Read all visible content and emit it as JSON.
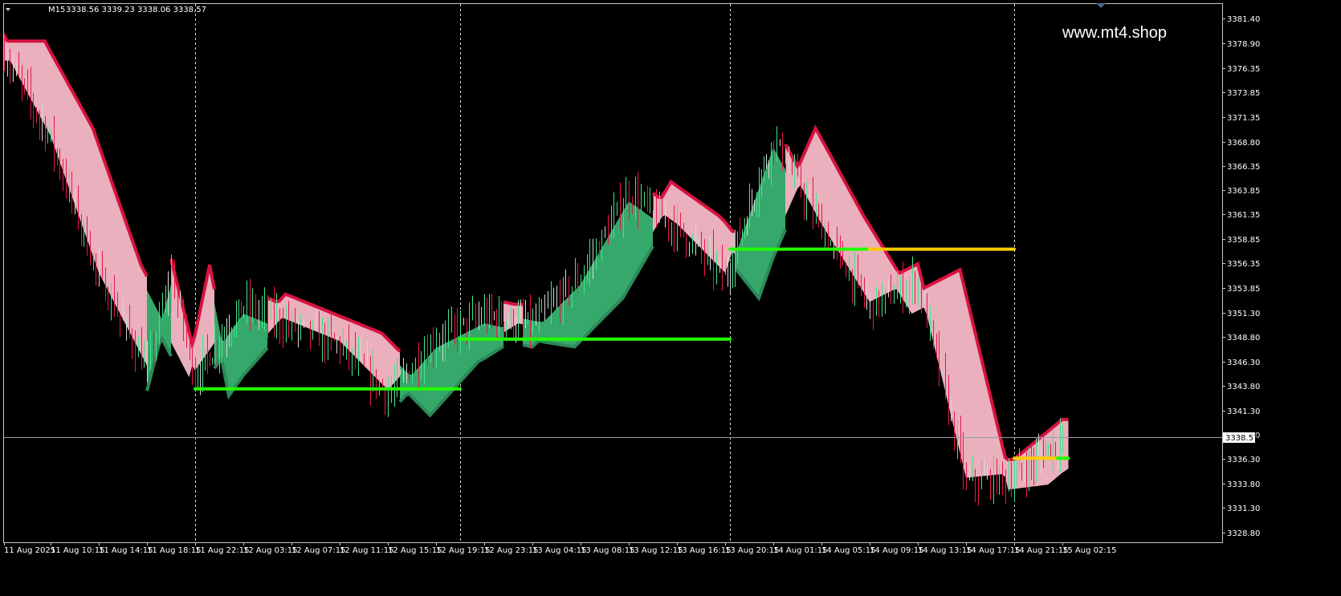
{
  "header": {
    "timeframe": "M15",
    "ohlc": "3338.56 3339.23 3338.06 3338.57"
  },
  "watermark": "www.mt4.shop",
  "colors": {
    "background": "#000000",
    "frame": "#c8c8c8",
    "grid": "#ffffff",
    "bull_candle": "#3ee68e",
    "bear_candle": "#e8174a",
    "doji_candle": "#d8d8d8",
    "bear_band_fill": "#eab0bd",
    "bear_band_edge": "#d6123f",
    "bull_band_fill": "#37a86b",
    "bull_band_edge": "#2c8a58",
    "level_bull": "#22ff00",
    "level_bear": "#ffcc00",
    "price_line": "#8fa0b0"
  },
  "chart_data": {
    "type": "candlestick",
    "symbol_timeframe": "M15",
    "current_price": "3338.57",
    "ylim": [
      3327.8,
      3382.9
    ],
    "y_ticks": [
      "3381.40",
      "3378.90",
      "3376.35",
      "3373.85",
      "3371.35",
      "3368.80",
      "3366.35",
      "3363.85",
      "3361.35",
      "3358.85",
      "3356.35",
      "3353.85",
      "3351.30",
      "3348.80",
      "3346.30",
      "3343.80",
      "3341.30",
      "3338.80",
      "3336.30",
      "3333.80",
      "3331.30",
      "3328.80"
    ],
    "x_ticks": [
      "11 Aug 2025",
      "11 Aug 10:15",
      "11 Aug 14:15",
      "11 Aug 18:15",
      "11 Aug 22:15",
      "12 Aug 03:15",
      "12 Aug 07:15",
      "12 Aug 11:15",
      "12 Aug 15:15",
      "12 Aug 19:15",
      "12 Aug 23:15",
      "13 Aug 04:15",
      "13 Aug 08:15",
      "13 Aug 12:15",
      "13 Aug 16:15",
      "13 Aug 20:15",
      "14 Aug 01:15",
      "14 Aug 05:15",
      "14 Aug 09:15",
      "14 Aug 13:15",
      "14 Aug 17:15",
      "14 Aug 21:15",
      "15 Aug 02:15"
    ],
    "day_separators": [
      "11 Aug 22:15",
      "12 Aug 21:15",
      "13 Aug 20:45",
      "14 Aug 21:15"
    ],
    "price_path": [
      [
        "11 Aug 2025",
        3377.9
      ],
      [
        "11 Aug 10:15",
        3369.0
      ],
      [
        "11 Aug 14:15",
        3355.0
      ],
      [
        "11 Aug 18:15",
        3345.5
      ],
      [
        "11 Aug 20:15",
        3355.0
      ],
      [
        "11 Aug 22:15",
        3345.0
      ],
      [
        "12 Aug 03:15",
        3352.0
      ],
      [
        "12 Aug 07:15",
        3350.0
      ],
      [
        "12 Aug 11:15",
        3348.0
      ],
      [
        "12 Aug 15:15",
        3343.0
      ],
      [
        "12 Aug 19:15",
        3348.5
      ],
      [
        "12 Aug 23:15",
        3351.0
      ],
      [
        "13 Aug 04:15",
        3350.0
      ],
      [
        "13 Aug 08:15",
        3355.0
      ],
      [
        "13 Aug 12:15",
        3363.5
      ],
      [
        "13 Aug 16:15",
        3360.0
      ],
      [
        "13 Aug 20:15",
        3355.0
      ],
      [
        "14 Aug 01:15",
        3369.0
      ],
      [
        "14 Aug 05:15",
        3360.0
      ],
      [
        "14 Aug 09:15",
        3352.0
      ],
      [
        "14 Aug 13:15",
        3354.5
      ],
      [
        "14 Aug 17:15",
        3334.0
      ],
      [
        "14 Aug 21:15",
        3334.5
      ],
      [
        "15 Aug 02:15",
        3338.57
      ]
    ],
    "band_segments": [
      {
        "trend": "bear",
        "from": "11 Aug 2025",
        "to": "11 Aug 18:15"
      },
      {
        "trend": "bull",
        "from": "11 Aug 18:15",
        "to": "11 Aug 20:15"
      },
      {
        "trend": "bear",
        "from": "11 Aug 20:15",
        "to": "12 Aug 00:15"
      },
      {
        "trend": "bull",
        "from": "12 Aug 00:15",
        "to": "12 Aug 05:15"
      },
      {
        "trend": "bear",
        "from": "12 Aug 05:15",
        "to": "12 Aug 16:15"
      },
      {
        "trend": "bull",
        "from": "12 Aug 16:15",
        "to": "13 Aug 01:15"
      },
      {
        "trend": "bear",
        "from": "13 Aug 01:15",
        "to": "13 Aug 03:15"
      },
      {
        "trend": "bull",
        "from": "13 Aug 03:15",
        "to": "13 Aug 14:15"
      },
      {
        "trend": "bear",
        "from": "13 Aug 14:15",
        "to": "13 Aug 21:15"
      },
      {
        "trend": "bull",
        "from": "13 Aug 21:15",
        "to": "14 Aug 02:15"
      },
      {
        "trend": "bear",
        "from": "14 Aug 02:15",
        "to": "15 Aug 02:45"
      }
    ],
    "levels": [
      {
        "price": 3343.5,
        "from": "11 Aug 22:15",
        "to": "12 Aug 21:15",
        "color": "level_bull"
      },
      {
        "price": 3348.6,
        "from": "12 Aug 21:15",
        "to": "13 Aug 20:45",
        "color": "level_bull"
      },
      {
        "price": 3357.8,
        "from": "13 Aug 20:45",
        "to": "14 Aug 09:15",
        "color": "level_bull"
      },
      {
        "price": 3357.8,
        "from": "14 Aug 09:15",
        "to": "14 Aug 21:15",
        "color": "level_bear"
      },
      {
        "price": 3336.4,
        "from": "14 Aug 21:15",
        "to": "15 Aug 01:45",
        "color": "level_bear"
      },
      {
        "price": 3336.4,
        "from": "15 Aug 01:45",
        "to": "15 Aug 02:45",
        "color": "level_bull"
      }
    ]
  }
}
